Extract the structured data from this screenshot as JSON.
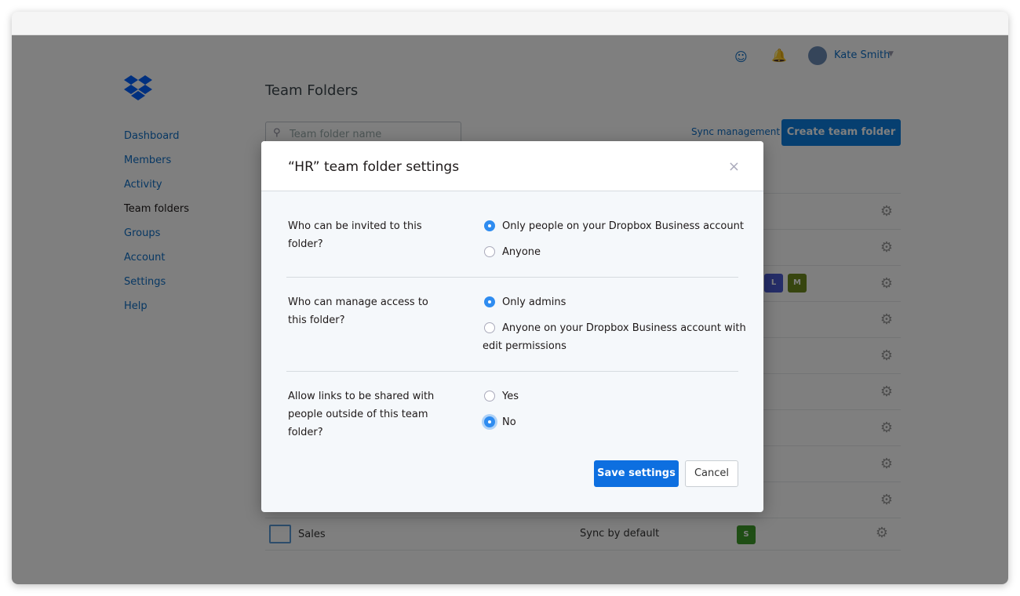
{
  "sidebar": {
    "items": [
      "Dashboard",
      "Members",
      "Activity",
      "Team folders",
      "Groups",
      "Account",
      "Settings",
      "Help"
    ],
    "active": "Team folders"
  },
  "header": {
    "user_name": "Kate Smith"
  },
  "main": {
    "title": "Team Folders",
    "search_placeholder": "Team folder name",
    "sync_management": "Sync management",
    "create_button": "Create team folder",
    "row_badges": [
      "L",
      "M"
    ],
    "last_row": {
      "name": "Sales",
      "sync": "Sync by default",
      "badge": "S"
    }
  },
  "colors": {
    "accent": "#0d6fe0",
    "badge_l": "#4a5bd0",
    "badge_m": "#6f8a1e",
    "badge_s": "#3f9c2a"
  },
  "modal": {
    "title": "“HR” team folder settings",
    "close": "×",
    "sections": [
      {
        "question": "Who can be invited to this folder?",
        "options": [
          "Only people on your Dropbox Business account",
          "Anyone"
        ],
        "selected": 0
      },
      {
        "question": "Who can manage access to this folder?",
        "options": [
          "Only admins",
          "Anyone on your Dropbox Business account with edit permissions"
        ],
        "selected": 0
      },
      {
        "question": "Allow links to be shared with people outside of this team folder?",
        "options": [
          "Yes",
          "No"
        ],
        "selected": 1
      }
    ],
    "save": "Save settings",
    "cancel": "Cancel"
  }
}
